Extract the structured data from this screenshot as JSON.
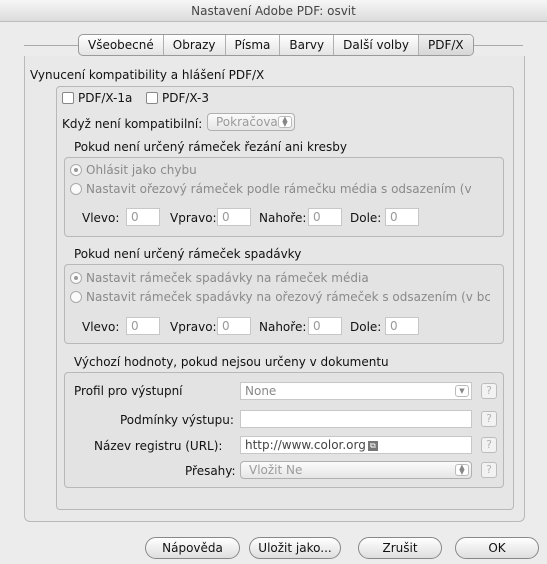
{
  "window": {
    "title": "Nastavení Adobe PDF: osvit"
  },
  "tabs": [
    "Všeobecné",
    "Obrazy",
    "Písma",
    "Barvy",
    "Další volby",
    "PDF/X"
  ],
  "section_main": {
    "title": "Vynucení kompatibility a hlášení PDF/X"
  },
  "checks": {
    "pdfx1a": "PDF/X-1a",
    "pdfx3": "PDF/X-3"
  },
  "noncompliant": {
    "label": "Když není kompatibilní:",
    "value": "Pokračovat"
  },
  "trim": {
    "title": "Pokud není určený rámeček řezání ani kresby",
    "option1": "Ohlásit jako chybu",
    "option2": "Nastavit ořezový rámeček podle rámečku média s odsazením (v",
    "left_label": "Vlevo:",
    "left": "0",
    "right_label": "Vpravo:",
    "right": "0",
    "top_label": "Nahoře:",
    "top": "0",
    "bottom_label": "Dole:",
    "bottom": "0"
  },
  "bleed": {
    "title": "Pokud není určený rámeček spadávky",
    "option1": "Nastavit rámeček spadávky na rámeček média",
    "option2": "Nastavit rámeček spadávky na ořezový rámeček s odsazením (v bc",
    "left_label": "Vlevo:",
    "left": "0",
    "right_label": "Vpravo:",
    "right": "0",
    "top_label": "Nahoře:",
    "top": "0",
    "bottom_label": "Dole:",
    "bottom": "0"
  },
  "defaults": {
    "title": "Výchozí hodnoty, pokud nejsou určeny v dokumentu",
    "profile_label": "Profil pro výstupní",
    "profile_value": "None",
    "condition_label": "Podmínky výstupu:",
    "condition_value": "",
    "registry_label": "Název registru (URL):",
    "registry_value": "http://www.color.org",
    "trapped_label": "Přesahy:",
    "trapped_value": "Vložit Ne",
    "help": "?"
  },
  "buttons": {
    "help": "Nápověda",
    "save": "Uložit jako...",
    "cancel": "Zrušit",
    "ok": "OK"
  }
}
